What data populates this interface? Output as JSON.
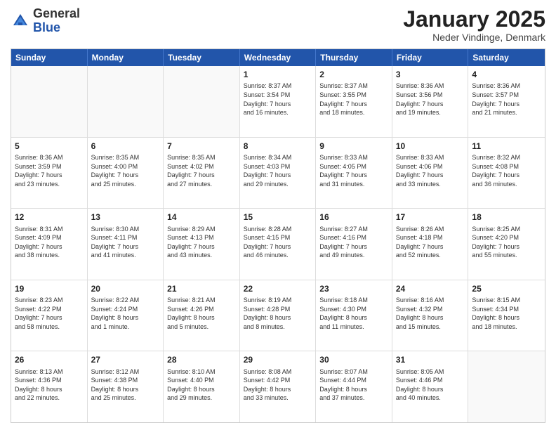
{
  "logo": {
    "general": "General",
    "blue": "Blue"
  },
  "title": "January 2025",
  "location": "Neder Vindinge, Denmark",
  "header_days": [
    "Sunday",
    "Monday",
    "Tuesday",
    "Wednesday",
    "Thursday",
    "Friday",
    "Saturday"
  ],
  "weeks": [
    [
      {
        "day": "",
        "text": ""
      },
      {
        "day": "",
        "text": ""
      },
      {
        "day": "",
        "text": ""
      },
      {
        "day": "1",
        "text": "Sunrise: 8:37 AM\nSunset: 3:54 PM\nDaylight: 7 hours\nand 16 minutes."
      },
      {
        "day": "2",
        "text": "Sunrise: 8:37 AM\nSunset: 3:55 PM\nDaylight: 7 hours\nand 18 minutes."
      },
      {
        "day": "3",
        "text": "Sunrise: 8:36 AM\nSunset: 3:56 PM\nDaylight: 7 hours\nand 19 minutes."
      },
      {
        "day": "4",
        "text": "Sunrise: 8:36 AM\nSunset: 3:57 PM\nDaylight: 7 hours\nand 21 minutes."
      }
    ],
    [
      {
        "day": "5",
        "text": "Sunrise: 8:36 AM\nSunset: 3:59 PM\nDaylight: 7 hours\nand 23 minutes."
      },
      {
        "day": "6",
        "text": "Sunrise: 8:35 AM\nSunset: 4:00 PM\nDaylight: 7 hours\nand 25 minutes."
      },
      {
        "day": "7",
        "text": "Sunrise: 8:35 AM\nSunset: 4:02 PM\nDaylight: 7 hours\nand 27 minutes."
      },
      {
        "day": "8",
        "text": "Sunrise: 8:34 AM\nSunset: 4:03 PM\nDaylight: 7 hours\nand 29 minutes."
      },
      {
        "day": "9",
        "text": "Sunrise: 8:33 AM\nSunset: 4:05 PM\nDaylight: 7 hours\nand 31 minutes."
      },
      {
        "day": "10",
        "text": "Sunrise: 8:33 AM\nSunset: 4:06 PM\nDaylight: 7 hours\nand 33 minutes."
      },
      {
        "day": "11",
        "text": "Sunrise: 8:32 AM\nSunset: 4:08 PM\nDaylight: 7 hours\nand 36 minutes."
      }
    ],
    [
      {
        "day": "12",
        "text": "Sunrise: 8:31 AM\nSunset: 4:09 PM\nDaylight: 7 hours\nand 38 minutes."
      },
      {
        "day": "13",
        "text": "Sunrise: 8:30 AM\nSunset: 4:11 PM\nDaylight: 7 hours\nand 41 minutes."
      },
      {
        "day": "14",
        "text": "Sunrise: 8:29 AM\nSunset: 4:13 PM\nDaylight: 7 hours\nand 43 minutes."
      },
      {
        "day": "15",
        "text": "Sunrise: 8:28 AM\nSunset: 4:15 PM\nDaylight: 7 hours\nand 46 minutes."
      },
      {
        "day": "16",
        "text": "Sunrise: 8:27 AM\nSunset: 4:16 PM\nDaylight: 7 hours\nand 49 minutes."
      },
      {
        "day": "17",
        "text": "Sunrise: 8:26 AM\nSunset: 4:18 PM\nDaylight: 7 hours\nand 52 minutes."
      },
      {
        "day": "18",
        "text": "Sunrise: 8:25 AM\nSunset: 4:20 PM\nDaylight: 7 hours\nand 55 minutes."
      }
    ],
    [
      {
        "day": "19",
        "text": "Sunrise: 8:23 AM\nSunset: 4:22 PM\nDaylight: 7 hours\nand 58 minutes."
      },
      {
        "day": "20",
        "text": "Sunrise: 8:22 AM\nSunset: 4:24 PM\nDaylight: 8 hours\nand 1 minute."
      },
      {
        "day": "21",
        "text": "Sunrise: 8:21 AM\nSunset: 4:26 PM\nDaylight: 8 hours\nand 5 minutes."
      },
      {
        "day": "22",
        "text": "Sunrise: 8:19 AM\nSunset: 4:28 PM\nDaylight: 8 hours\nand 8 minutes."
      },
      {
        "day": "23",
        "text": "Sunrise: 8:18 AM\nSunset: 4:30 PM\nDaylight: 8 hours\nand 11 minutes."
      },
      {
        "day": "24",
        "text": "Sunrise: 8:16 AM\nSunset: 4:32 PM\nDaylight: 8 hours\nand 15 minutes."
      },
      {
        "day": "25",
        "text": "Sunrise: 8:15 AM\nSunset: 4:34 PM\nDaylight: 8 hours\nand 18 minutes."
      }
    ],
    [
      {
        "day": "26",
        "text": "Sunrise: 8:13 AM\nSunset: 4:36 PM\nDaylight: 8 hours\nand 22 minutes."
      },
      {
        "day": "27",
        "text": "Sunrise: 8:12 AM\nSunset: 4:38 PM\nDaylight: 8 hours\nand 25 minutes."
      },
      {
        "day": "28",
        "text": "Sunrise: 8:10 AM\nSunset: 4:40 PM\nDaylight: 8 hours\nand 29 minutes."
      },
      {
        "day": "29",
        "text": "Sunrise: 8:08 AM\nSunset: 4:42 PM\nDaylight: 8 hours\nand 33 minutes."
      },
      {
        "day": "30",
        "text": "Sunrise: 8:07 AM\nSunset: 4:44 PM\nDaylight: 8 hours\nand 37 minutes."
      },
      {
        "day": "31",
        "text": "Sunrise: 8:05 AM\nSunset: 4:46 PM\nDaylight: 8 hours\nand 40 minutes."
      },
      {
        "day": "",
        "text": ""
      }
    ]
  ]
}
